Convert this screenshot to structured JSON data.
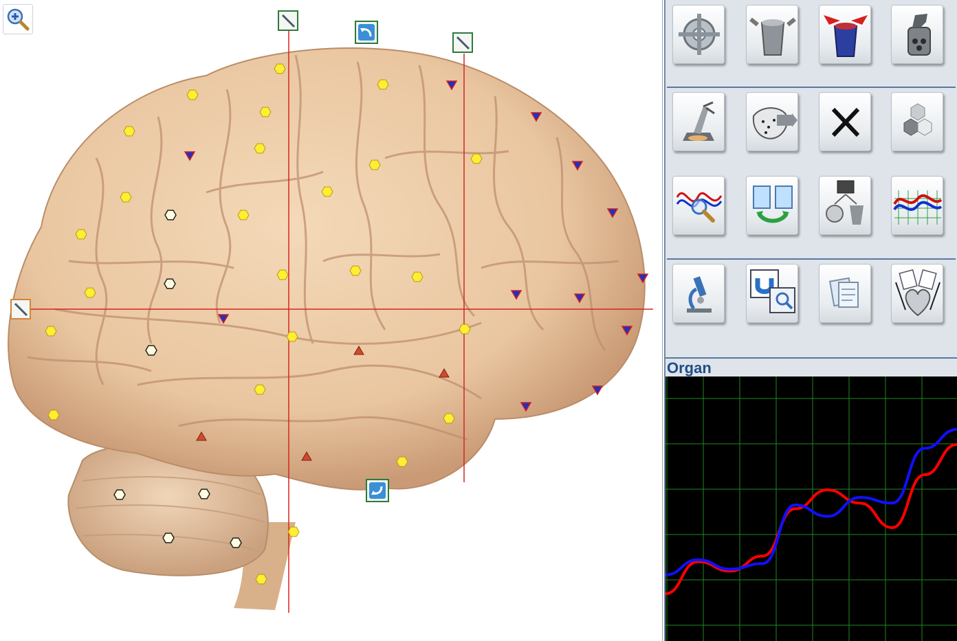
{
  "viewer": {
    "zoom_icon": "zoom-in-magnifier-icon",
    "markers": {
      "yellow_hex": "#ffee33",
      "white_hex": "#fffde0",
      "blue_triangle": "#2230c0",
      "red_triangle": "#d04a2c"
    },
    "crosshair_color": "#d8241c"
  },
  "tools": [
    {
      "name": "navigation-target-icon"
    },
    {
      "name": "gray-container-icon"
    },
    {
      "name": "blue-red-container-icon"
    },
    {
      "name": "spray-bottle-icon"
    },
    {
      "name": "grinder-icon"
    },
    {
      "name": "map-scan-icon"
    },
    {
      "name": "close-x-icon"
    },
    {
      "name": "hexagon-cluster-icon"
    },
    {
      "name": "wave-magnifier-icon"
    },
    {
      "name": "clipboard-exchange-icon"
    },
    {
      "name": "diagnostic-transfer-icon"
    },
    {
      "name": "multi-wave-chart-icon"
    },
    {
      "name": "microscope-icon"
    },
    {
      "name": "magnet-inspect-icon"
    },
    {
      "name": "documents-icon"
    },
    {
      "name": "heart-organ-icon"
    }
  ],
  "organ_panel": {
    "title": "Organ"
  },
  "chart_data": {
    "type": "line",
    "title": "Organ",
    "grid": true,
    "x": [
      0,
      1,
      2,
      3,
      4,
      5,
      6,
      7,
      8,
      9,
      10,
      11,
      12,
      13,
      14,
      15,
      16
    ],
    "series": [
      {
        "color": "#1010ff",
        "values": [
          0.35,
          0.43,
          0.38,
          0.41,
          0.72,
          0.66,
          0.76,
          0.73,
          1.02,
          1.12
        ]
      },
      {
        "color": "#ff0000",
        "values": [
          0.25,
          0.42,
          0.37,
          0.45,
          0.7,
          0.8,
          0.73,
          0.6,
          0.88,
          1.04
        ]
      }
    ],
    "series_x": [
      0,
      1,
      2,
      3,
      4,
      5,
      6,
      7,
      8,
      9
    ],
    "ylim": [
      0,
      1.4
    ],
    "background": "#000000",
    "grid_color": "#1f8a1f"
  }
}
